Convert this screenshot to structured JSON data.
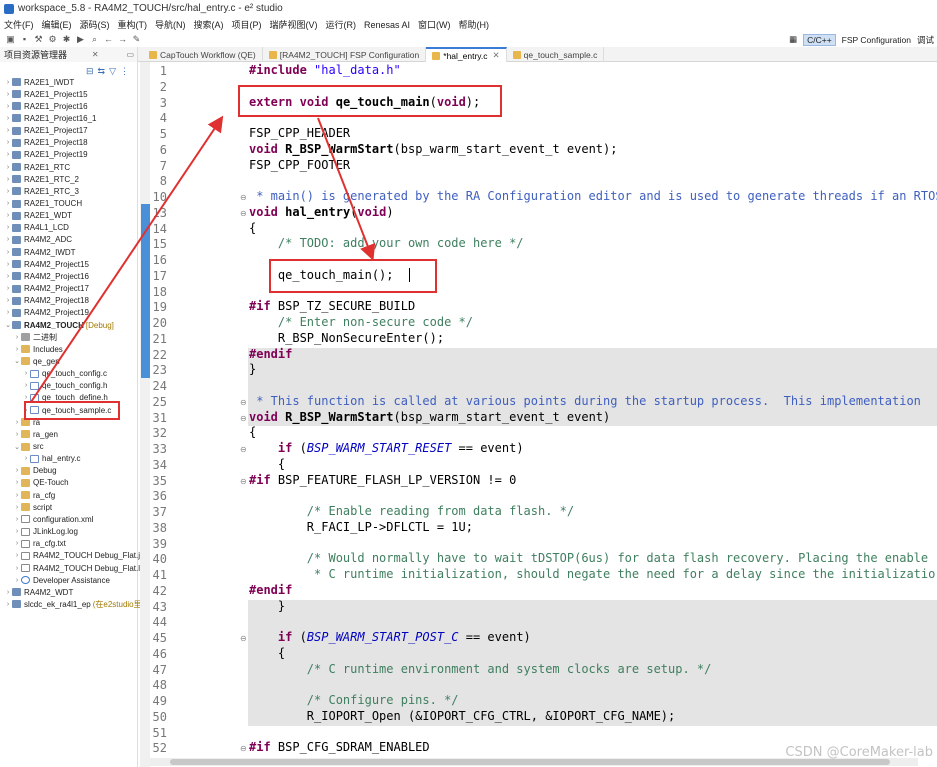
{
  "window": {
    "title": "workspace_5.8 - RA4M2_TOUCH/src/hal_entry.c - e² studio"
  },
  "menu": [
    "文件(F)",
    "编辑(E)",
    "源码(S)",
    "重构(T)",
    "导航(N)",
    "搜索(A)",
    "项目(P)",
    "瑞萨视图(V)",
    "运行(R)",
    "Renesas AI",
    "窗口(W)",
    "帮助(H)"
  ],
  "perspectives": {
    "items": [
      "C/C++",
      "FSP Configuration",
      "调试"
    ],
    "active": "C/C++"
  },
  "left_panel": {
    "title": "项目资源管理器"
  },
  "editor_tabs": [
    {
      "label": "CapTouch Workflow (QE)"
    },
    {
      "label": "[RA4M2_TOUCH] FSP Configuration"
    },
    {
      "label": "*hal_entry.c",
      "active": true
    },
    {
      "label": "qe_touch_sample.c"
    }
  ],
  "tree": [
    {
      "label": "RA2E1_IWDT",
      "type": "proj",
      "indent": 0
    },
    {
      "label": "RA2E1_Project15",
      "type": "proj",
      "indent": 0
    },
    {
      "label": "RA2E1_Project16",
      "type": "proj",
      "indent": 0
    },
    {
      "label": "RA2E1_Project16_1",
      "type": "proj",
      "indent": 0
    },
    {
      "label": "RA2E1_Project17",
      "type": "proj",
      "indent": 0
    },
    {
      "label": "RA2E1_Project18",
      "type": "proj",
      "indent": 0
    },
    {
      "label": "RA2E1_Project19",
      "type": "proj",
      "indent": 0
    },
    {
      "label": "RA2E1_RTC",
      "type": "proj",
      "indent": 0
    },
    {
      "label": "RA2E1_RTC_2",
      "type": "proj",
      "indent": 0
    },
    {
      "label": "RA2E1_RTC_3",
      "type": "proj",
      "indent": 0
    },
    {
      "label": "RA2E1_TOUCH",
      "type": "proj",
      "indent": 0
    },
    {
      "label": "RA2E1_WDT",
      "type": "proj",
      "indent": 0
    },
    {
      "label": "RA4L1_LCD",
      "type": "proj",
      "indent": 0
    },
    {
      "label": "RA4M2_ADC",
      "type": "proj",
      "indent": 0
    },
    {
      "label": "RA4M2_IWDT",
      "type": "proj",
      "indent": 0
    },
    {
      "label": "RA4M2_Project15",
      "type": "proj",
      "indent": 0
    },
    {
      "label": "RA4M2_Project16",
      "type": "proj",
      "indent": 0
    },
    {
      "label": "RA4M2_Project17",
      "type": "proj",
      "indent": 0
    },
    {
      "label": "RA4M2_Project18",
      "type": "proj",
      "indent": 0
    },
    {
      "label": "RA4M2_Project19",
      "type": "proj",
      "indent": 0
    },
    {
      "label": "RA4M2_TOUCH",
      "type": "proj",
      "indent": 0,
      "bold": true,
      "suffix": "[Debug]",
      "open": true
    },
    {
      "label": "二进制",
      "type": "bin",
      "indent": 1
    },
    {
      "label": "Includes",
      "type": "folder",
      "indent": 1
    },
    {
      "label": "qe_gen",
      "type": "folder",
      "indent": 1,
      "open": true
    },
    {
      "label": "qe_touch_config.c",
      "type": "cfile",
      "indent": 2
    },
    {
      "label": "qe_touch_config.h",
      "type": "cfile",
      "indent": 2
    },
    {
      "label": "qe_touch_define.h",
      "type": "cfile",
      "indent": 2
    },
    {
      "label": "qe_touch_sample.c",
      "type": "cfile",
      "indent": 2
    },
    {
      "label": "ra",
      "type": "folder",
      "indent": 1
    },
    {
      "label": "ra_gen",
      "type": "folder",
      "indent": 1
    },
    {
      "label": "src",
      "type": "folder",
      "indent": 1,
      "open": true
    },
    {
      "label": "hal_entry.c",
      "type": "cfile",
      "indent": 2
    },
    {
      "label": "Debug",
      "type": "folder",
      "indent": 1
    },
    {
      "label": "QE-Touch",
      "type": "folder",
      "indent": 1
    },
    {
      "label": "ra_cfg",
      "type": "folder",
      "indent": 1
    },
    {
      "label": "script",
      "type": "folder",
      "indent": 1
    },
    {
      "label": "configuration.xml",
      "type": "file",
      "indent": 1
    },
    {
      "label": "JLinkLog.log",
      "type": "file",
      "indent": 1
    },
    {
      "label": "ra_cfg.txt",
      "type": "file",
      "indent": 1
    },
    {
      "label": "RA4M2_TOUCH Debug_Flat.j",
      "type": "file",
      "indent": 1
    },
    {
      "label": "RA4M2_TOUCH Debug_Flat.l",
      "type": "file",
      "indent": 1
    },
    {
      "label": "Developer Assistance",
      "type": "help",
      "indent": 1
    },
    {
      "label": "RA4M2_WDT",
      "type": "proj",
      "indent": 0
    },
    {
      "label": "slcdc_ek_ra4l1_ep",
      "type": "proj",
      "indent": 0,
      "suffix": "(在e2studio里"
    }
  ],
  "code": [
    {
      "n": "1",
      "t": "#include \"hal_data.h\""
    },
    {
      "n": "2",
      "t": ""
    },
    {
      "n": "3",
      "t": "extern void qe_touch_main(void);"
    },
    {
      "n": "4",
      "t": ""
    },
    {
      "n": "5",
      "t": "FSP_CPP_HEADER"
    },
    {
      "n": "6",
      "t": "void R_BSP_WarmStart(bsp_warm_start_event_t event);"
    },
    {
      "n": "7",
      "t": "FSP_CPP_FOOTER"
    },
    {
      "n": "8",
      "t": ""
    },
    {
      "n": "10",
      "t": " * main() is generated by the RA Configuration editor and is used to generate threads if an RTOS"
    },
    {
      "n": "13",
      "t": "void hal_entry(void)"
    },
    {
      "n": "14",
      "t": "{"
    },
    {
      "n": "15",
      "t": "    /* TODO: add your own code here */"
    },
    {
      "n": "16",
      "t": ""
    },
    {
      "n": "17",
      "t": "    qe_touch_main();"
    },
    {
      "n": "18",
      "t": ""
    },
    {
      "n": "19",
      "t": "#if BSP_TZ_SECURE_BUILD"
    },
    {
      "n": "20",
      "t": "    /* Enter non-secure code */"
    },
    {
      "n": "21",
      "t": "    R_BSP_NonSecureEnter();"
    },
    {
      "n": "22",
      "t": "#endif"
    },
    {
      "n": "23",
      "t": "}"
    },
    {
      "n": "24",
      "t": ""
    },
    {
      "n": "25",
      "t": " * This function is called at various points during the startup process.  This implementation"
    },
    {
      "n": "31",
      "t": "void R_BSP_WarmStart(bsp_warm_start_event_t event)"
    },
    {
      "n": "32",
      "t": "{"
    },
    {
      "n": "33",
      "t": "    if (BSP_WARM_START_RESET == event)"
    },
    {
      "n": "34",
      "t": "    {"
    },
    {
      "n": "35",
      "t": "#if BSP_FEATURE_FLASH_LP_VERSION != 0"
    },
    {
      "n": "36",
      "t": ""
    },
    {
      "n": "37",
      "t": "        /* Enable reading from data flash. */"
    },
    {
      "n": "38",
      "t": "        R_FACI_LP->DFLCTL = 1U;"
    },
    {
      "n": "39",
      "t": ""
    },
    {
      "n": "40",
      "t": "        /* Would normally have to wait tDSTOP(6us) for data flash recovery. Placing the enable"
    },
    {
      "n": "41",
      "t": "         * C runtime initialization, should negate the need for a delay since the initializatio"
    },
    {
      "n": "42",
      "t": "#endif"
    },
    {
      "n": "43",
      "t": "    }"
    },
    {
      "n": "44",
      "t": ""
    },
    {
      "n": "45",
      "t": "    if (BSP_WARM_START_POST_C == event)"
    },
    {
      "n": "46",
      "t": "    {"
    },
    {
      "n": "47",
      "t": "        /* C runtime environment and system clocks are setup. */"
    },
    {
      "n": "48",
      "t": ""
    },
    {
      "n": "49",
      "t": "        /* Configure pins. */"
    },
    {
      "n": "50",
      "t": "        R_IOPORT_Open (&IOPORT_CFG_CTRL, &IOPORT_CFG_NAME);"
    },
    {
      "n": "51",
      "t": ""
    },
    {
      "n": "52",
      "t": "#if BSP_CFG_SDRAM_ENABLED"
    }
  ],
  "watermark": "CSDN @CoreMaker-lab"
}
